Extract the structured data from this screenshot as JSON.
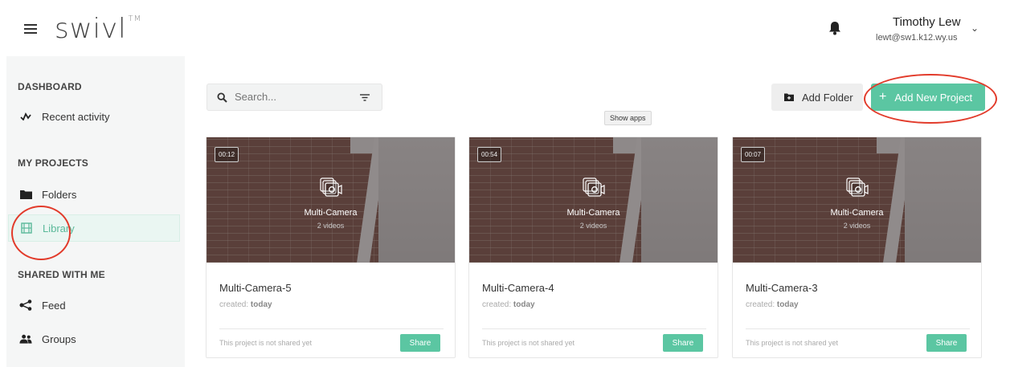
{
  "header": {
    "logo_text": "swivl",
    "logo_tm": "TM",
    "user_name": "Timothy Lew",
    "user_email": "lewt@sw1.k12.wy.us"
  },
  "sidebar": {
    "sections": [
      {
        "title": "DASHBOARD"
      },
      {
        "title": "MY PROJECTS"
      },
      {
        "title": "SHARED WITH ME"
      }
    ],
    "items": [
      {
        "label": "Recent activity",
        "icon": "activity-icon"
      },
      {
        "label": "Folders",
        "icon": "folder-icon"
      },
      {
        "label": "Library",
        "icon": "film-icon",
        "active": true
      },
      {
        "label": "Feed",
        "icon": "share-icon"
      },
      {
        "label": "Groups",
        "icon": "groups-icon"
      }
    ]
  },
  "toolbar": {
    "search_placeholder": "Search...",
    "add_folder_label": "Add Folder",
    "add_project_label": "Add New Project",
    "tooltip": "Show apps"
  },
  "cards": [
    {
      "duration": "00:12",
      "type_label": "Multi-Camera",
      "count": "2 videos",
      "title": "Multi-Camera-5",
      "created_prefix": "created:",
      "created_value": "today",
      "share_status": "This project is not shared yet",
      "share_label": "Share"
    },
    {
      "duration": "00:54",
      "type_label": "Multi-Camera",
      "count": "2 videos",
      "title": "Multi-Camera-4",
      "created_prefix": "created:",
      "created_value": "today",
      "share_status": "This project is not shared yet",
      "share_label": "Share"
    },
    {
      "duration": "00:07",
      "type_label": "Multi-Camera",
      "count": "2 videos",
      "title": "Multi-Camera-3",
      "created_prefix": "created:",
      "created_value": "today",
      "share_status": "This project is not shared yet",
      "share_label": "Share"
    }
  ],
  "colors": {
    "accent": "#5bc6a2",
    "annotation_circle": "#e23b2b"
  }
}
